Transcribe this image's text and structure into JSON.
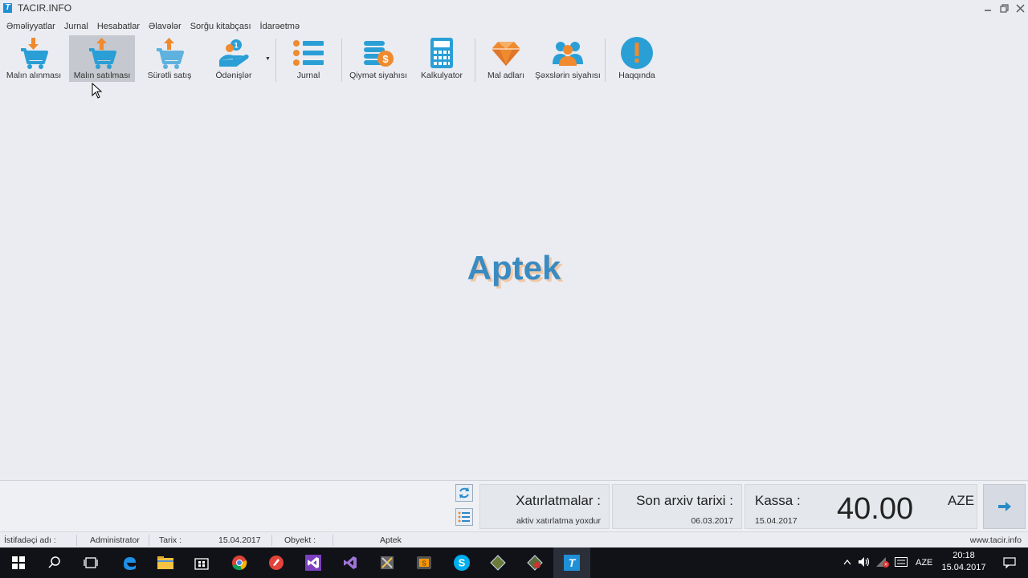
{
  "window": {
    "title": "TACIR.INFO",
    "logo_letter": "T"
  },
  "menu": [
    "Əməliyyatlar",
    "Jurnal",
    "Hesabatlar",
    "Əlavələr",
    "Sorğu kitabçası",
    "İdarəetmə"
  ],
  "ribbon": {
    "buttons": [
      {
        "label": "Malın alınması"
      },
      {
        "label": "Malın satılması"
      },
      {
        "label": "Sürətli satış"
      },
      {
        "label": "Ödənişlər"
      },
      {
        "label": "Jurnal"
      },
      {
        "label": "Qiymət siyahısı"
      },
      {
        "label": "Kalkulyator"
      },
      {
        "label": "Mal adları"
      },
      {
        "label": "Şəxslərin siyahısı"
      },
      {
        "label": "Haqqında"
      }
    ],
    "active_index": 1,
    "currency_symbol": "$",
    "badge_number": "1"
  },
  "center_logo": "Aptek",
  "bottom": {
    "reservations_title": "Xatırlatmalar :",
    "reservations_sub": "aktiv xatırlatma yoxdur",
    "archive_title": "Son arxiv tarixi :",
    "archive_date": "06.03.2017",
    "kassa_title": "Kassa :",
    "kassa_date": "15.04.2017",
    "kassa_value": "40.00",
    "currency": "AZE"
  },
  "status": {
    "user_label": "İstifadəçi adı :",
    "user_value": "Administrator",
    "date_label": "Tarix :",
    "date_value": "15.04.2017",
    "object_label": "Obyekt :",
    "object_value": "Aptek",
    "website": "www.tacir.info"
  },
  "taskbar": {
    "lang": "AZE",
    "time": "20:18",
    "date": "15.04.2017"
  },
  "colors": {
    "accent_blue": "#3a8bc2",
    "orange": "#f08a2e",
    "teal": "#2a9fd6",
    "logo_shadow": "#f0c9a9"
  }
}
